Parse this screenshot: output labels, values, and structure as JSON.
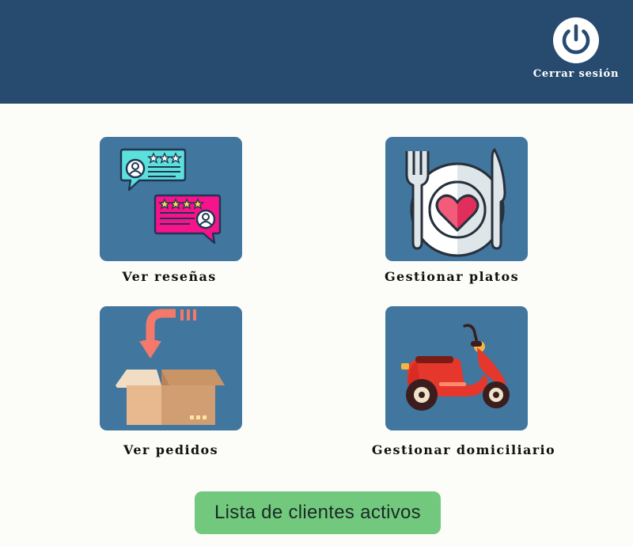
{
  "header": {
    "logout_label": "Cerrar sesión",
    "icon": "power-icon",
    "background": "#264b6f"
  },
  "cards": [
    {
      "label": "Ver reseñas",
      "icon": "reviews-icon"
    },
    {
      "label": "Gestionar platos",
      "icon": "plate-cutlery-icon"
    },
    {
      "label": "Ver pedidos",
      "icon": "package-box-icon"
    },
    {
      "label": "Gestionar domiciliario",
      "icon": "scooter-icon"
    }
  ],
  "cta": {
    "label": "Lista de clientes activos",
    "color": "#72c97e"
  },
  "colors": {
    "card_background": "#41769f",
    "page_background": "#fcfcf8"
  }
}
